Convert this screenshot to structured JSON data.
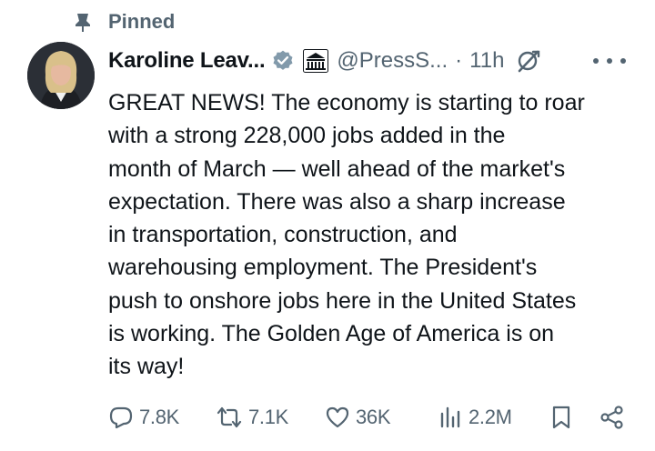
{
  "pinned": {
    "label": "Pinned",
    "icon": "pin-icon"
  },
  "author": {
    "display_name": "Karoline Leav...",
    "verified_badge_color": "#829aab",
    "handle": "@PressS...",
    "separator": "·",
    "time": "11h"
  },
  "tweet": {
    "text": "GREAT NEWS! The economy is starting to roar\nwith a strong 228,000 jobs added in the\nmonth of March — well ahead of the market's\nexpectation. There was also a sharp increase\nin transportation, construction, and\nwarehousing employment. The President's\npush to onshore jobs here in the United States\nis working. The Golden Age of America is on\nits way!"
  },
  "actions": {
    "replies": "7.8K",
    "reposts": "7.1K",
    "likes": "36K",
    "views": "2.2M"
  },
  "colors": {
    "text": "#0f1419",
    "secondary": "#536471",
    "background": "#ffffff"
  }
}
